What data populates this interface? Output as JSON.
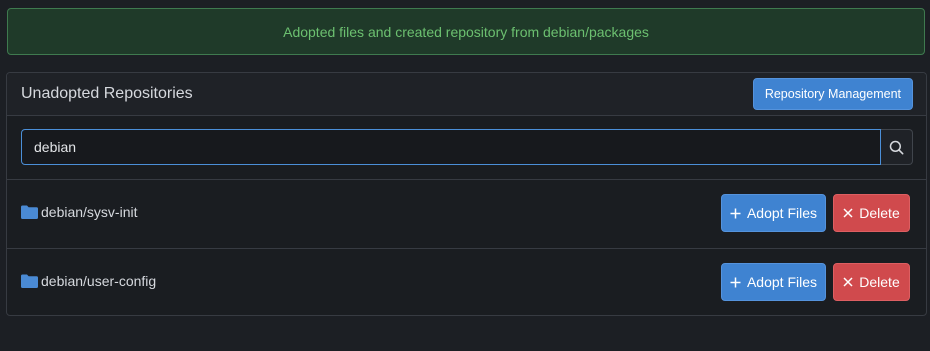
{
  "flash": {
    "message": "Adopted files and created repository from debian/packages"
  },
  "panel": {
    "title": "Unadopted Repositories",
    "management_button": "Repository Management"
  },
  "search": {
    "value": "debian",
    "icon": "search-icon"
  },
  "repos": [
    {
      "name": "debian/sysv-init",
      "adopt_label": "Adopt Files",
      "delete_label": "Delete"
    },
    {
      "name": "debian/user-config",
      "adopt_label": "Adopt Files",
      "delete_label": "Delete"
    }
  ],
  "colors": {
    "primary": "#3f83d1",
    "danger": "#d04a4d",
    "success_text": "#6cc070",
    "background": "#1c1f24"
  }
}
